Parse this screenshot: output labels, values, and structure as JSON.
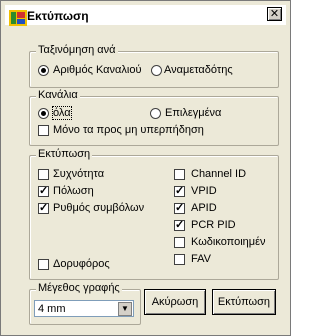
{
  "window": {
    "title": "Εκτύπωση",
    "close_glyph": "✕",
    "icon": "app-icon"
  },
  "sort_group": {
    "legend": "Ταξινόμηση ανά",
    "options": [
      {
        "label": "Αριθμός Καναλιού",
        "selected": true
      },
      {
        "label": "Αναμεταδότης",
        "selected": false
      }
    ]
  },
  "channels_group": {
    "legend": "Κανάλια",
    "options": [
      {
        "label": "όλα",
        "selected": true
      },
      {
        "label": "Επιλεγμένα",
        "selected": false
      }
    ],
    "protected_only": {
      "label": "Μόνο τα προς μη υπερπήδηση",
      "checked": false
    }
  },
  "print_group": {
    "legend": "Εκτύπωση",
    "left": [
      {
        "label": "Συχνότητα",
        "checked": false
      },
      {
        "label": "Πόλωση",
        "checked": true
      },
      {
        "label": "Ρυθμός συμβόλων",
        "checked": true
      },
      {
        "label": "Δορυφόρος",
        "checked": false
      }
    ],
    "right": [
      {
        "label": "Channel ID",
        "checked": false
      },
      {
        "label": "VPID",
        "checked": true
      },
      {
        "label": "APID",
        "checked": true
      },
      {
        "label": "PCR PID",
        "checked": true
      },
      {
        "label": "Κωδικοποιημέν",
        "checked": false
      },
      {
        "label": "FAV",
        "checked": false
      }
    ]
  },
  "font_size": {
    "legend": "Μέγεθος γραφής",
    "value": "4 mm"
  },
  "buttons": {
    "cancel": "Ακύρωση",
    "print": "Εκτύπωση"
  },
  "check_glyph": "✓"
}
